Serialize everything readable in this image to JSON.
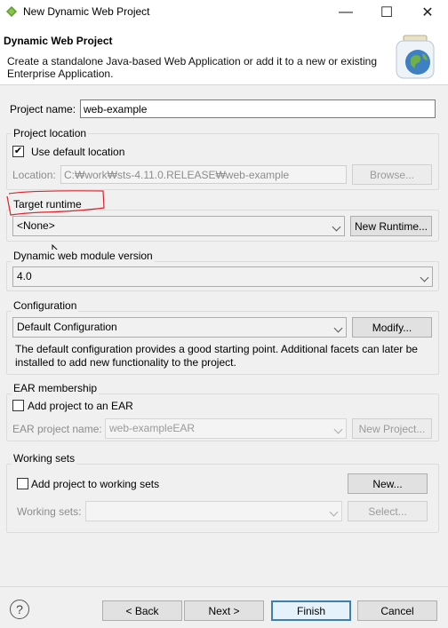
{
  "window": {
    "title": "New Dynamic Web Project",
    "minimize": "—",
    "maximize": "☐",
    "close": "✕"
  },
  "header": {
    "title": "Dynamic Web Project",
    "description": "Create a standalone Java-based Web Application or add it to a new or existing Enterprise Application."
  },
  "project_name": {
    "label": "Project name:",
    "value": "web-example"
  },
  "project_location": {
    "title": "Project location",
    "use_default_label": "Use default location",
    "use_default_checked": true,
    "location_label": "Location:",
    "location_value": "C:₩work₩sts-4.11.0.RELEASE₩web-example",
    "browse": "Browse..."
  },
  "target_runtime": {
    "title": "Target runtime",
    "value": "<None>",
    "new_runtime": "New Runtime..."
  },
  "module_version": {
    "title": "Dynamic web module version",
    "value": "4.0"
  },
  "configuration": {
    "title": "Configuration",
    "value": "Default Configuration",
    "modify": "Modify...",
    "note": "The default configuration provides a good starting point. Additional facets can later be installed to add new functionality to the project."
  },
  "ear": {
    "title": "EAR membership",
    "add_label": "Add project to an EAR",
    "checked": false,
    "name_label": "EAR project name:",
    "name_value": "web-exampleEAR",
    "new_project": "New Project..."
  },
  "working_sets": {
    "title": "Working sets",
    "add_label": "Add project to working sets",
    "checked": false,
    "new": "New...",
    "sets_label": "Working sets:",
    "sets_value": "",
    "select": "Select..."
  },
  "footer": {
    "help": "?",
    "back": "< Back",
    "next": "Next >",
    "finish": "Finish",
    "cancel": "Cancel"
  },
  "colors": {
    "annotation": "#e0202a",
    "accent": "#3c7fb1"
  }
}
